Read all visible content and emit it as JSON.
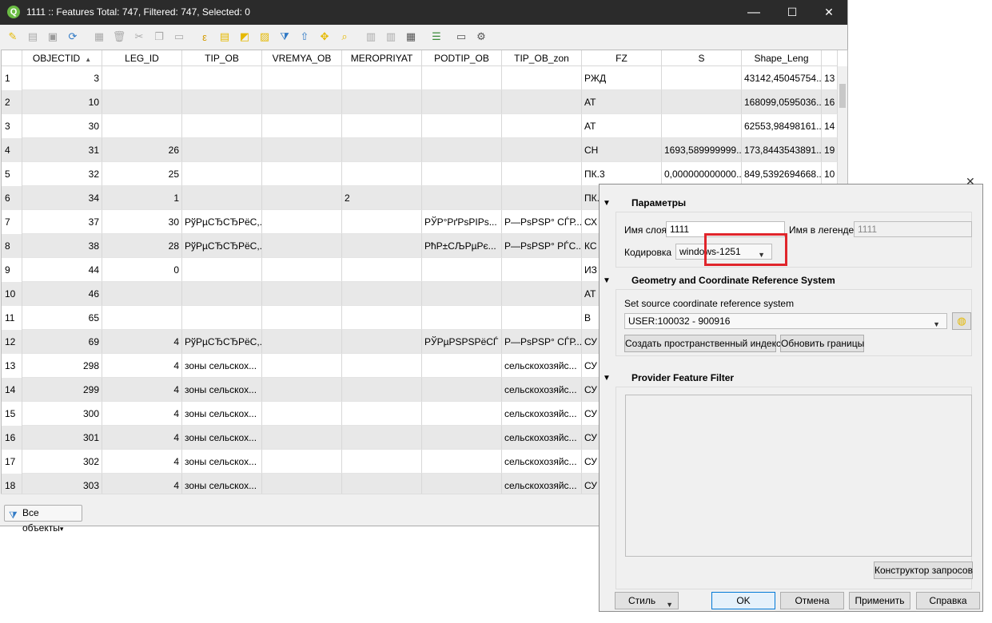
{
  "window": {
    "title": "1111 :: Features Total: 747, Filtered: 747, Selected: 0",
    "logo_letter": "Q",
    "minimize": "—",
    "maximize": "☐",
    "close": "✕"
  },
  "toolbar": {
    "icons": [
      "pencil-icon",
      "multi-edit-icon",
      "save-icon",
      "reload-icon",
      "add-feature-icon",
      "delete-icon",
      "cut-icon",
      "copy-icon",
      "paste-icon",
      "select-expression-icon",
      "select-all-icon",
      "invert-selection-icon",
      "deselect-icon",
      "filter-icon",
      "move-selection-top-icon",
      "pan-to-selection-icon",
      "zoom-to-selection-icon",
      "new-field-icon",
      "delete-field-icon",
      "field-calculator-icon",
      "conditional-format-icon",
      "dock-icon",
      "actions-icon"
    ]
  },
  "table": {
    "columns": [
      "",
      "OBJECTID",
      "LEG_ID",
      "TIP_OB",
      "VREMYA_OB",
      "MEROPRIYAT",
      "PODTIP_OB",
      "TIP_OB_zon",
      "FZ",
      "S",
      "Shape_Leng",
      ""
    ],
    "sort_indicator": "▲",
    "rows": [
      {
        "n": "1",
        "objectid": "3",
        "leg_id": "",
        "tip_ob": "",
        "vremya": "",
        "merop": "",
        "podtip": "",
        "tip_zon": "",
        "fz": "РЖД",
        "s": "",
        "shape": "43142,45045754...",
        "extra": "13"
      },
      {
        "n": "2",
        "objectid": "10",
        "leg_id": "",
        "tip_ob": "",
        "vremya": "",
        "merop": "",
        "podtip": "",
        "tip_zon": "",
        "fz": "АТ",
        "s": "",
        "shape": "168099,0595036...",
        "extra": "16"
      },
      {
        "n": "3",
        "objectid": "30",
        "leg_id": "",
        "tip_ob": "",
        "vremya": "",
        "merop": "",
        "podtip": "",
        "tip_zon": "",
        "fz": "АТ",
        "s": "",
        "shape": "62553,98498161...",
        "extra": "14"
      },
      {
        "n": "4",
        "objectid": "31",
        "leg_id": "26",
        "tip_ob": "",
        "vremya": "",
        "merop": "",
        "podtip": "",
        "tip_zon": "",
        "fz": "СН",
        "s": "1693,589999999...",
        "shape": "173,8443543891...",
        "extra": "19"
      },
      {
        "n": "5",
        "objectid": "32",
        "leg_id": "25",
        "tip_ob": "",
        "vremya": "",
        "merop": "",
        "podtip": "",
        "tip_zon": "",
        "fz": "ПК.3",
        "s": "0,000000000000...",
        "shape": "849,5392694668...",
        "extra": "10"
      },
      {
        "n": "6",
        "objectid": "34",
        "leg_id": "1",
        "tip_ob": "",
        "vremya": "",
        "merop": "2",
        "podtip": "",
        "tip_zon": "",
        "fz": "ПК.",
        "s": "",
        "shape": "",
        "extra": ""
      },
      {
        "n": "7",
        "objectid": "37",
        "leg_id": "30",
        "tip_ob": "РўРµСЂСЂРёС,...",
        "vremya": "",
        "merop": "",
        "podtip": "РЎР°РґРѕРІРѕ...",
        "tip_zon": "Р—РѕРЅР° СЃР...",
        "fz": "СХ",
        "s": "",
        "shape": "",
        "extra": ""
      },
      {
        "n": "8",
        "objectid": "38",
        "leg_id": "28",
        "tip_ob": "РўРµСЂСЂРёС,...",
        "vremya": "",
        "merop": "",
        "podtip": "РћР±СЉРµРє...",
        "tip_zon": "Р—РѕРЅР° РЃС...",
        "fz": "КС",
        "s": "",
        "shape": "",
        "extra": ""
      },
      {
        "n": "9",
        "objectid": "44",
        "leg_id": "0",
        "tip_ob": "",
        "vremya": "",
        "merop": "",
        "podtip": "",
        "tip_zon": "",
        "fz": "ИЗ",
        "s": "",
        "shape": "",
        "extra": ""
      },
      {
        "n": "10",
        "objectid": "46",
        "leg_id": "",
        "tip_ob": "",
        "vremya": "",
        "merop": "",
        "podtip": "",
        "tip_zon": "",
        "fz": "АТ",
        "s": "",
        "shape": "",
        "extra": ""
      },
      {
        "n": "11",
        "objectid": "65",
        "leg_id": "",
        "tip_ob": "",
        "vremya": "",
        "merop": "",
        "podtip": "",
        "tip_zon": "",
        "fz": "В",
        "s": "",
        "shape": "",
        "extra": ""
      },
      {
        "n": "12",
        "objectid": "69",
        "leg_id": "4",
        "tip_ob": "РўРµСЂСЂРёС,...",
        "vremya": "",
        "merop": "",
        "podtip": "РЎРµРЅРЅРёСЃ",
        "tip_zon": "Р—РѕРЅР° СЃР...",
        "fz": "СУ",
        "s": "",
        "shape": "",
        "extra": ""
      },
      {
        "n": "13",
        "objectid": "298",
        "leg_id": "4",
        "tip_ob": "зоны сельскох...",
        "vremya": "",
        "merop": "",
        "podtip": "",
        "tip_zon": "сельскохозяйс...",
        "fz": "СУ",
        "s": "",
        "shape": "",
        "extra": ""
      },
      {
        "n": "14",
        "objectid": "299",
        "leg_id": "4",
        "tip_ob": "зоны сельскох...",
        "vremya": "",
        "merop": "",
        "podtip": "",
        "tip_zon": "сельскохозяйс...",
        "fz": "СУ",
        "s": "",
        "shape": "",
        "extra": ""
      },
      {
        "n": "15",
        "objectid": "300",
        "leg_id": "4",
        "tip_ob": "зоны сельскох...",
        "vremya": "",
        "merop": "",
        "podtip": "",
        "tip_zon": "сельскохозяйс...",
        "fz": "СУ",
        "s": "",
        "shape": "",
        "extra": ""
      },
      {
        "n": "16",
        "objectid": "301",
        "leg_id": "4",
        "tip_ob": "зоны сельскох...",
        "vremya": "",
        "merop": "",
        "podtip": "",
        "tip_zon": "сельскохозяйс...",
        "fz": "СУ",
        "s": "",
        "shape": "",
        "extra": ""
      },
      {
        "n": "17",
        "objectid": "302",
        "leg_id": "4",
        "tip_ob": "зоны сельскох...",
        "vremya": "",
        "merop": "",
        "podtip": "",
        "tip_zon": "сельскохозяйс...",
        "fz": "СУ",
        "s": "",
        "shape": "",
        "extra": ""
      },
      {
        "n": "18",
        "objectid": "303",
        "leg_id": "4",
        "tip_ob": "зоны сельскох...",
        "vremya": "",
        "merop": "",
        "podtip": "",
        "tip_zon": "сельскохозяйс...",
        "fz": "СУ",
        "s": "",
        "shape": "",
        "extra": ""
      }
    ]
  },
  "filter": {
    "label": "Все объекты",
    "arrow": "▾"
  },
  "dialog": {
    "close": "✕",
    "params_title": "Параметры",
    "layer_name_label": "Имя слоя",
    "layer_name_value": "1111",
    "legend_label": "Имя в легенде",
    "legend_placeholder": "1111",
    "encoding_label": "Кодировка",
    "encoding_value": "windows-1251",
    "geo_title": "Geometry and Coordinate Reference System",
    "crs_label": "Set source coordinate reference system",
    "crs_value": "USER:100032 - 900916",
    "spatial_index_button": "Создать пространственный индекс",
    "update_extents_button": "Обновить границы",
    "filter_title": "Provider Feature Filter",
    "query_builder_button": "Конструктор запросов",
    "style_button": "Стиль",
    "ok_button": "OK",
    "cancel_button": "Отмена",
    "apply_button": "Применить",
    "help_button": "Справка"
  },
  "colors": {
    "titlebar": "#2b2b2b",
    "highlight": "#e0252b",
    "alt_row": "#e8e8e8",
    "qgis_green": "#6bbd44"
  }
}
